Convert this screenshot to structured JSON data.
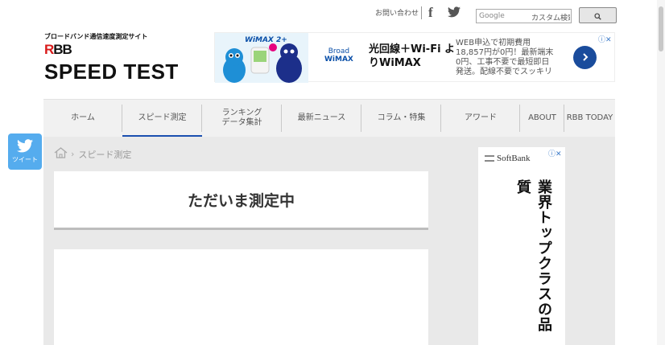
{
  "util": {
    "contact": "お問い合わせ",
    "facebook_glyph": "f",
    "search_placeholder": "Google",
    "search_custom": "カスタム検索"
  },
  "logo": {
    "subtitle": "ブロードバンド通信速度測定サイト",
    "rbb_r": "R",
    "rbb_bb": "BB",
    "title": "SPEED TEST"
  },
  "header_ad": {
    "tag": "WiMAX 2+",
    "brand_line1": "Broad",
    "brand_line2": "WiMAX",
    "headline": "光回線＋Wi-Fi よりWiMAX",
    "desc": "WEB申込で初期費用18,857円が0円！最新端末0円、工事不要で最短即日発送。配線不要でスッキリ",
    "choice": "ⓘ✕"
  },
  "nav": {
    "items": [
      {
        "label": "ホーム"
      },
      {
        "label": "スピード測定"
      },
      {
        "label": "ランキング\nデータ集計"
      },
      {
        "label": "最新ニュース"
      },
      {
        "label": "コラム・特集"
      },
      {
        "label": "アワード"
      },
      {
        "label": "ABOUT"
      },
      {
        "label": "RBB TODAY"
      }
    ]
  },
  "tweet": {
    "label": "ツイート"
  },
  "breadcrumb": {
    "chevron": "›",
    "current": "スピード測定"
  },
  "status": {
    "heading": "ただいま測定中"
  },
  "side_ad": {
    "brand": "SoftBank",
    "choice": "ⓘ✕",
    "copy": "業界トップクラスの品質"
  },
  "colors": {
    "accent": "#1b4fb0",
    "twitter": "#55acee",
    "logo_red": "#d91a1a"
  }
}
